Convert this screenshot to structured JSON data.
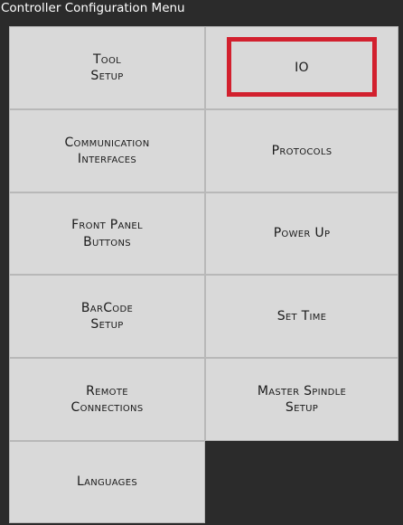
{
  "window": {
    "title": "Controller Configuration Menu"
  },
  "menu": {
    "items": [
      {
        "label": "Tool\nSetup"
      },
      {
        "label": "IO"
      },
      {
        "label": "Communication\nInterfaces"
      },
      {
        "label": "Protocols"
      },
      {
        "label": "Front Panel\nButtons"
      },
      {
        "label": "Power Up"
      },
      {
        "label": "BarCode\nSetup"
      },
      {
        "label": "Set Time"
      },
      {
        "label": "Remote\nConnections"
      },
      {
        "label": "Master Spindle\nSetup"
      },
      {
        "label": "Languages"
      }
    ],
    "selected_index": 1
  },
  "colors": {
    "background": "#2b2b2b",
    "tile": "#d9d9d9",
    "highlight": "#d2202e"
  }
}
